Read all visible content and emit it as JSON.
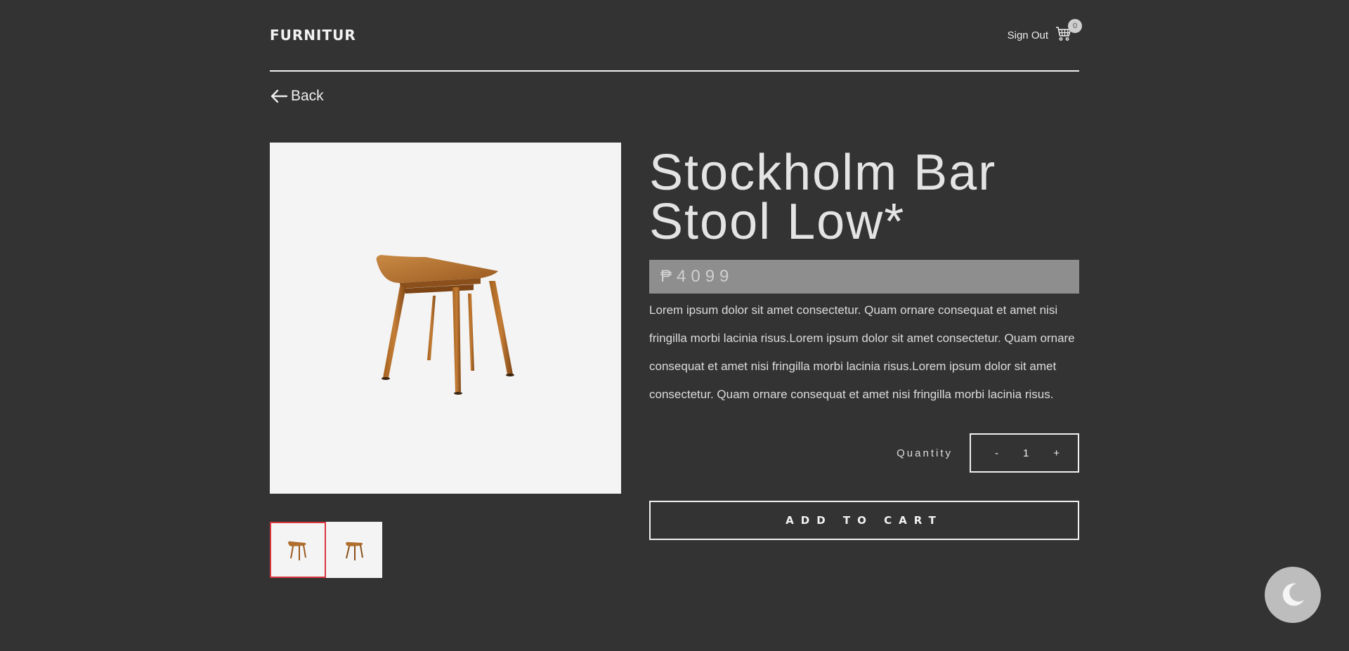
{
  "header": {
    "logo": "FURNITUR",
    "sign_out": "Sign Out",
    "cart_count": "0"
  },
  "nav": {
    "back_label": "Back"
  },
  "product": {
    "title_line1": "Stockholm Bar",
    "title_line2": "Stool Low*",
    "price": "₱4099",
    "description": "Lorem ipsum dolor sit amet consectetur. Quam ornare consequat et amet nisi fringilla morbi lacinia risus.Lorem ipsum dolor sit amet consectetur. Quam ornare consequat et amet nisi fringilla morbi lacinia risus.Lorem ipsum dolor sit amet consectetur. Quam ornare consequat et amet nisi fringilla morbi lacinia risus.",
    "quantity_label": "Quantity",
    "quantity_value": "1",
    "decrement_label": "-",
    "increment_label": "+",
    "add_to_cart_label": "ADD TO CART",
    "thumbnails": [
      "stool-front",
      "stool-angle"
    ]
  },
  "colors": {
    "background": "#333333",
    "price_bar": "#8e8e8e",
    "active_thumb_border": "#d9363e",
    "wood": "#b06f2c"
  },
  "icons": {
    "back": "arrow-left-icon",
    "cart": "cart-icon",
    "theme": "moon-icon"
  }
}
